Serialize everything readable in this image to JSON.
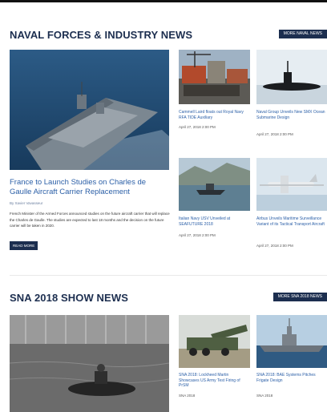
{
  "section1": {
    "title": "NAVAL FORCES & INDUSTRY NEWS",
    "more_label": "MORE NAVAL NEWS",
    "lead": {
      "title": "France to Launch Studies on Charles de Gaulle Aircraft Carrier Replacement",
      "meta": "By Xavier Vavasseur",
      "excerpt": "French Minister of the Armed Forces announced studies on the future aircraft carrier that will replace the Charles de Gaulle. The studies are expected to last 18 months and the decision on the future carrier will be taken in 2020.",
      "read_more_label": "READ MORE"
    },
    "cards": [
      {
        "title": "Cammell Laird floats out Royal Navy RFA TIDE Auxiliary",
        "date": "April 27, 2018 2:00 PM"
      },
      {
        "title": "Naval Group Unveils New SMX Ocean Submarine Design",
        "date": "April 27, 2018 2:00 PM"
      },
      {
        "title": "Italian Navy USV Unveiled at SEAFUTURE 2018",
        "date": "April 27, 2018 2:00 PM"
      },
      {
        "title": "Airbus Unveils Maritime Surveillance Variant of its Tactical Transport Aircraft",
        "date": "April 27, 2018 2:00 PM"
      }
    ]
  },
  "section2": {
    "title": "SNA 2018 SHOW NEWS",
    "more_label": "MORE SNA 2018 NEWS",
    "cards": [
      {
        "title": "SNA 2018: Lockheed Martin Showcases US Army Test Firing of PrSM",
        "date": "SNA 2018"
      },
      {
        "title": "SNA 2018: BAE Systems Pitches Frigate Design",
        "date": "SNA 2018"
      }
    ]
  }
}
